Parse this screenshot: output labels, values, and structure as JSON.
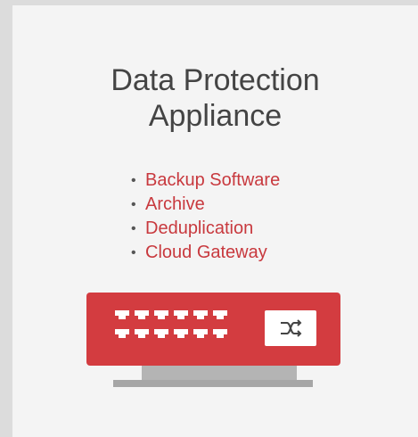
{
  "card": {
    "title_line1": "Data Protection",
    "title_line2": "Appliance",
    "features": [
      "Backup Software",
      "Archive",
      "Deduplication",
      "Cloud Gateway"
    ],
    "bullet": "•"
  },
  "illustration": {
    "device_icon": "network-appliance-icon",
    "port_icon": "ethernet-port-icon",
    "switch_icon": "switch-arrows-icon",
    "port_count": 12
  },
  "colors": {
    "accent": "#d33c40",
    "feature_text": "#c8393e",
    "title_text": "#444444",
    "card_bg": "#f4f4f4",
    "stand": "#b4b4b4"
  }
}
